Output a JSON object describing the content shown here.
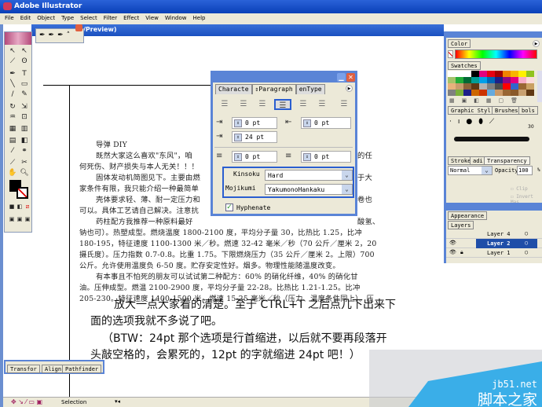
{
  "app": {
    "title": "Adobe Illustrator",
    "doc_title_fragment": "/Preview)"
  },
  "menu": [
    "File",
    "Edit",
    "Object",
    "Type",
    "Select",
    "Filter",
    "Effect",
    "View",
    "Window",
    "Help"
  ],
  "pen_tools": [
    "pen-icon",
    "add-anchor-icon",
    "delete-anchor-icon",
    "convert-anchor-icon"
  ],
  "document": {
    "lines": [
      "导弹 DIY",
      "既然大家这么喜欢\"东风\"，咱",
      "何死伤、财产损失与本人无关！！！",
      "固体发动机简图见下。主要由燃",
      "家条件有限，我只能介绍一种最简单",
      "壳体要求轻、薄、耐一定压力和",
      "可以。具体工艺请自己解决。注意抗",
      "药柱配方我推荐一种原料最好",
      "钠也可）。热塑成型。燃烧温度 1800-2100 度，平均分子量 30，比热比 1.25，比冲",
      "180-195，特征速度 1100-1300 米／秒。燃速 32-42 毫米／秒（70 公斤／厘米 2，20",
      "摄氏度）。压力指数 0.7-0.8。比重 1.75。下限燃烧压力（35 公斤／厘米 2。上限）700",
      "公斤。允许使用温度负 6-50 度。贮存安定性好。烟多。物理性能随温度改变。",
      "有本事且不怕死的朋友可以试试第二种配方：60% 的硝化纤维，40% 的硝化甘",
      "油。压伸成型。燃温 2100-2900 度，平均分子量 22-28。比热比 1.21-1.25。比冲",
      "205-230。特征速度 1400-1500 米。燃速 15-25 毫米／秒（压力、温度条件同上）。压"
    ],
    "right_fragments": [
      "的任",
      "于大",
      "卷也",
      "酸氢、"
    ],
    "caption": [
      "放大一点大家看的清楚。至于 CTRL+T 之后点几下出来下",
      "面的选项我就不多说了吧。",
      "（BTW：24pt 那个选项是行首缩进，以后就不要再段落开",
      "头敲空格的，会累死的，12pt 的字就缩进 24pt 吧！）"
    ]
  },
  "paragraph_panel": {
    "tabs": [
      "Characte",
      "Paragraph",
      "enType"
    ],
    "left_indent": "0 pt",
    "right_indent": "0 pt",
    "first_line_indent": "24 pt",
    "space_before": "0 pt",
    "space_after": "0 pt",
    "kinsoku_label": "Kinsoku",
    "kinsoku_value": "Hard",
    "mojikumi_label": "Mojikumi",
    "mojikumi_value": "YakumonoHankaku",
    "hyphenate_label": "Hyphenate",
    "hyphenate_checked": true,
    "selected_alignment": "justify-left"
  },
  "right_panels": {
    "color_tab": "Color",
    "swatches_tab": "Swatches",
    "swatch_colors": [
      "#ffffff",
      "#ffffff",
      "#ffffff",
      "#000000",
      "#e4007f",
      "#e60012",
      "#a40000",
      "#f08300",
      "#f8b500",
      "#fff100",
      "#8fc31f",
      "#a4c36a",
      "#22ac38",
      "#006934",
      "#009e96",
      "#00a0e9",
      "#0068b7",
      "#1d2088",
      "#920783",
      "#e4007f",
      "#f6adc6",
      "#fadbda",
      "#e8b27c",
      "#c69c6d",
      "#8c6239",
      "#603813",
      "#b3b3b3",
      "#808080",
      "#4d4d4d",
      "#ff0000",
      "#3366cc",
      "#996633",
      "#c9a063",
      "#808080",
      "#7ab03a",
      "#1d2088",
      "#cc6600",
      "#cc3300",
      "#66aadd",
      "#cc9966",
      "#996633",
      "#8a5a2a",
      "#c8a070",
      "#603813"
    ],
    "styles_tabs": [
      "Graphic Styl",
      "Brushes",
      "bols"
    ],
    "brush_size": "30",
    "transparency_tabs": [
      "Stroke",
      "adi",
      "Transparency"
    ],
    "blend_mode": "Normal",
    "opacity_label": "Opacity",
    "opacity": "100",
    "opacity_unit": "%",
    "clip_label": "Clip",
    "invert_mask_label": "Invert Mas",
    "appearance_tab": "Appearance",
    "layers_tab": "Layers",
    "layers": [
      {
        "name": "Layer 4",
        "visible": false,
        "locked": false
      },
      {
        "name": "Layer 2",
        "visible": true,
        "locked": false,
        "selected": true
      },
      {
        "name": "Layer 1",
        "visible": true,
        "locked": true
      }
    ]
  },
  "bottom_panel": {
    "tabs": [
      "Transfor",
      "Align",
      "Pathfinder"
    ]
  },
  "status": {
    "tool": "Selection"
  },
  "watermark": {
    "url": "jb51.net",
    "name": "脚本之家"
  }
}
